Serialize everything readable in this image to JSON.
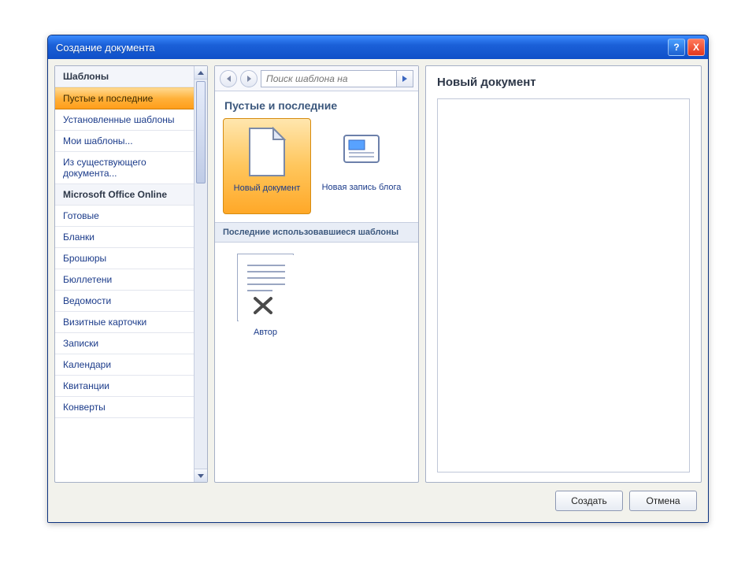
{
  "window": {
    "title": "Создание документа"
  },
  "sidebar": {
    "sections": [
      {
        "header": "Шаблоны",
        "items": [
          {
            "label": "Пустые и последние",
            "selected": true
          },
          {
            "label": "Установленные шаблоны"
          },
          {
            "label": "Мои шаблоны..."
          },
          {
            "label": "Из существующего документа..."
          }
        ]
      },
      {
        "header": "Microsoft Office Online",
        "items": [
          {
            "label": "Готовые"
          },
          {
            "label": "Бланки"
          },
          {
            "label": "Брошюры"
          },
          {
            "label": "Бюллетени"
          },
          {
            "label": "Ведомости"
          },
          {
            "label": "Визитные карточки"
          },
          {
            "label": "Записки"
          },
          {
            "label": "Календари"
          },
          {
            "label": "Квитанции"
          },
          {
            "label": "Конверты"
          }
        ]
      }
    ]
  },
  "center": {
    "search_placeholder": "Поиск шаблона на",
    "section_title": "Пустые и последние",
    "tiles": [
      {
        "label": "Новый документ",
        "selected": true
      },
      {
        "label": "Новая запись блога"
      }
    ],
    "recent_header": "Последние использовавшиеся шаблоны",
    "recent_tile": {
      "label": "Автор"
    }
  },
  "preview": {
    "title": "Новый документ"
  },
  "footer": {
    "create": "Создать",
    "cancel": "Отмена"
  },
  "titlebar": {
    "help": "?",
    "close": "X"
  },
  "colors": {
    "accent_select": "#ffb13a",
    "link": "#1b3b8a",
    "titlebar": "#1b60d8"
  }
}
